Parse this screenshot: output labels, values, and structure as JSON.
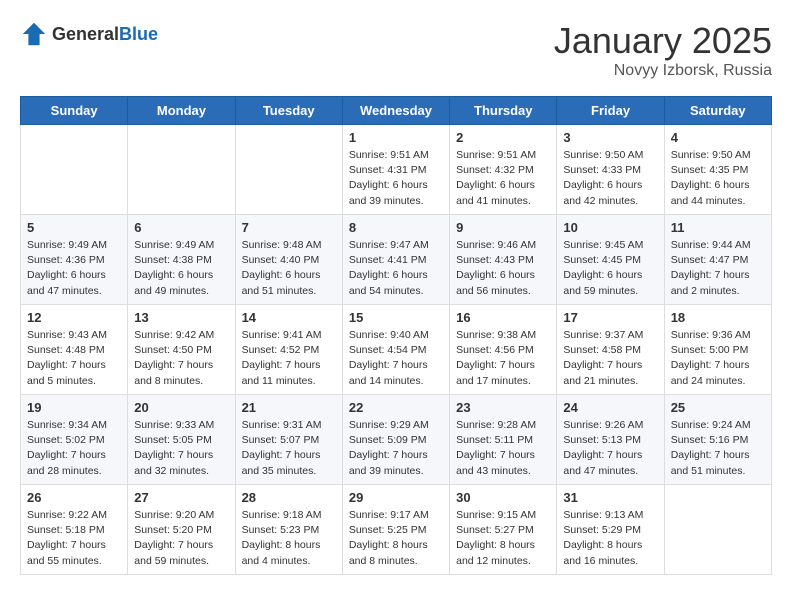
{
  "header": {
    "logo_general": "General",
    "logo_blue": "Blue",
    "month": "January 2025",
    "location": "Novyy Izborsk, Russia"
  },
  "weekdays": [
    "Sunday",
    "Monday",
    "Tuesday",
    "Wednesday",
    "Thursday",
    "Friday",
    "Saturday"
  ],
  "weeks": [
    [
      {
        "day": "",
        "info": ""
      },
      {
        "day": "",
        "info": ""
      },
      {
        "day": "",
        "info": ""
      },
      {
        "day": "1",
        "info": "Sunrise: 9:51 AM\nSunset: 4:31 PM\nDaylight: 6 hours\nand 39 minutes."
      },
      {
        "day": "2",
        "info": "Sunrise: 9:51 AM\nSunset: 4:32 PM\nDaylight: 6 hours\nand 41 minutes."
      },
      {
        "day": "3",
        "info": "Sunrise: 9:50 AM\nSunset: 4:33 PM\nDaylight: 6 hours\nand 42 minutes."
      },
      {
        "day": "4",
        "info": "Sunrise: 9:50 AM\nSunset: 4:35 PM\nDaylight: 6 hours\nand 44 minutes."
      }
    ],
    [
      {
        "day": "5",
        "info": "Sunrise: 9:49 AM\nSunset: 4:36 PM\nDaylight: 6 hours\nand 47 minutes."
      },
      {
        "day": "6",
        "info": "Sunrise: 9:49 AM\nSunset: 4:38 PM\nDaylight: 6 hours\nand 49 minutes."
      },
      {
        "day": "7",
        "info": "Sunrise: 9:48 AM\nSunset: 4:40 PM\nDaylight: 6 hours\nand 51 minutes."
      },
      {
        "day": "8",
        "info": "Sunrise: 9:47 AM\nSunset: 4:41 PM\nDaylight: 6 hours\nand 54 minutes."
      },
      {
        "day": "9",
        "info": "Sunrise: 9:46 AM\nSunset: 4:43 PM\nDaylight: 6 hours\nand 56 minutes."
      },
      {
        "day": "10",
        "info": "Sunrise: 9:45 AM\nSunset: 4:45 PM\nDaylight: 6 hours\nand 59 minutes."
      },
      {
        "day": "11",
        "info": "Sunrise: 9:44 AM\nSunset: 4:47 PM\nDaylight: 7 hours\nand 2 minutes."
      }
    ],
    [
      {
        "day": "12",
        "info": "Sunrise: 9:43 AM\nSunset: 4:48 PM\nDaylight: 7 hours\nand 5 minutes."
      },
      {
        "day": "13",
        "info": "Sunrise: 9:42 AM\nSunset: 4:50 PM\nDaylight: 7 hours\nand 8 minutes."
      },
      {
        "day": "14",
        "info": "Sunrise: 9:41 AM\nSunset: 4:52 PM\nDaylight: 7 hours\nand 11 minutes."
      },
      {
        "day": "15",
        "info": "Sunrise: 9:40 AM\nSunset: 4:54 PM\nDaylight: 7 hours\nand 14 minutes."
      },
      {
        "day": "16",
        "info": "Sunrise: 9:38 AM\nSunset: 4:56 PM\nDaylight: 7 hours\nand 17 minutes."
      },
      {
        "day": "17",
        "info": "Sunrise: 9:37 AM\nSunset: 4:58 PM\nDaylight: 7 hours\nand 21 minutes."
      },
      {
        "day": "18",
        "info": "Sunrise: 9:36 AM\nSunset: 5:00 PM\nDaylight: 7 hours\nand 24 minutes."
      }
    ],
    [
      {
        "day": "19",
        "info": "Sunrise: 9:34 AM\nSunset: 5:02 PM\nDaylight: 7 hours\nand 28 minutes."
      },
      {
        "day": "20",
        "info": "Sunrise: 9:33 AM\nSunset: 5:05 PM\nDaylight: 7 hours\nand 32 minutes."
      },
      {
        "day": "21",
        "info": "Sunrise: 9:31 AM\nSunset: 5:07 PM\nDaylight: 7 hours\nand 35 minutes."
      },
      {
        "day": "22",
        "info": "Sunrise: 9:29 AM\nSunset: 5:09 PM\nDaylight: 7 hours\nand 39 minutes."
      },
      {
        "day": "23",
        "info": "Sunrise: 9:28 AM\nSunset: 5:11 PM\nDaylight: 7 hours\nand 43 minutes."
      },
      {
        "day": "24",
        "info": "Sunrise: 9:26 AM\nSunset: 5:13 PM\nDaylight: 7 hours\nand 47 minutes."
      },
      {
        "day": "25",
        "info": "Sunrise: 9:24 AM\nSunset: 5:16 PM\nDaylight: 7 hours\nand 51 minutes."
      }
    ],
    [
      {
        "day": "26",
        "info": "Sunrise: 9:22 AM\nSunset: 5:18 PM\nDaylight: 7 hours\nand 55 minutes."
      },
      {
        "day": "27",
        "info": "Sunrise: 9:20 AM\nSunset: 5:20 PM\nDaylight: 7 hours\nand 59 minutes."
      },
      {
        "day": "28",
        "info": "Sunrise: 9:18 AM\nSunset: 5:23 PM\nDaylight: 8 hours\nand 4 minutes."
      },
      {
        "day": "29",
        "info": "Sunrise: 9:17 AM\nSunset: 5:25 PM\nDaylight: 8 hours\nand 8 minutes."
      },
      {
        "day": "30",
        "info": "Sunrise: 9:15 AM\nSunset: 5:27 PM\nDaylight: 8 hours\nand 12 minutes."
      },
      {
        "day": "31",
        "info": "Sunrise: 9:13 AM\nSunset: 5:29 PM\nDaylight: 8 hours\nand 16 minutes."
      },
      {
        "day": "",
        "info": ""
      }
    ]
  ]
}
